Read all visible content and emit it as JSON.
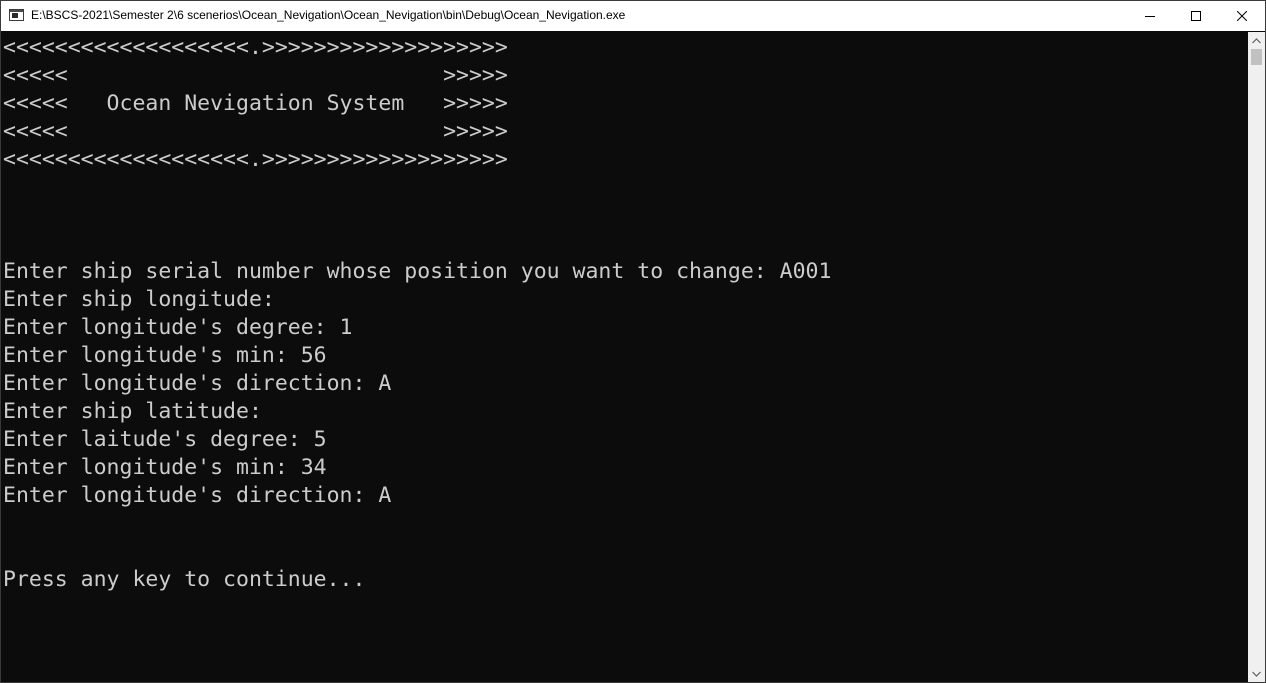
{
  "window": {
    "title": "E:\\BSCS-2021\\Semester 2\\6 scenerios\\Ocean_Nevigation\\Ocean_Nevigation\\bin\\Debug\\Ocean_Nevigation.exe",
    "icon": "console-app-icon",
    "controls": {
      "minimize": "minimize-icon",
      "maximize": "maximize-icon",
      "close": "close-icon"
    }
  },
  "console": {
    "lines": [
      "<<<<<<<<<<<<<<<<<<<.>>>>>>>>>>>>>>>>>>>",
      "<<<<<                             >>>>>",
      "<<<<<   Ocean Nevigation System   >>>>>",
      "<<<<<                             >>>>>",
      "<<<<<<<<<<<<<<<<<<<.>>>>>>>>>>>>>>>>>>>",
      "",
      "",
      "",
      "Enter ship serial number whose position you want to change: A001",
      "Enter ship longitude:",
      "Enter longitude's degree: 1",
      "Enter longitude's min: 56",
      "Enter longitude's direction: A",
      "Enter ship latitude:",
      "Enter laitude's degree: 5",
      "Enter longitude's min: 34",
      "Enter longitude's direction: A",
      "",
      "",
      "Press any key to continue..."
    ],
    "text_color": "#cccccc",
    "background_color": "#0c0c0c"
  },
  "scrollbar": {
    "up_icon": "scroll-up-arrow-icon",
    "down_icon": "scroll-down-arrow-icon"
  }
}
